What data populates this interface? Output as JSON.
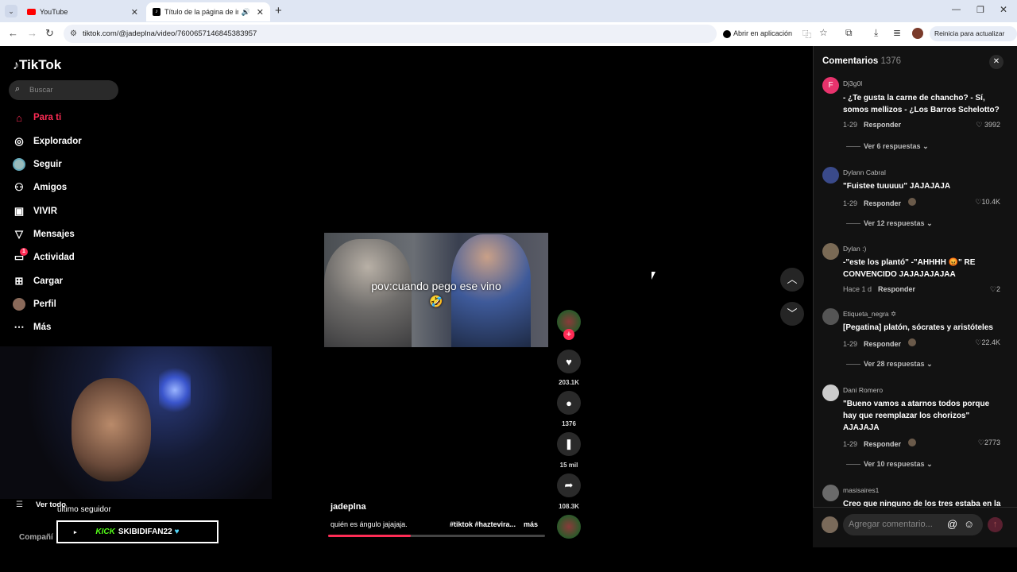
{
  "browser": {
    "tabs": [
      {
        "label": "YouTube",
        "active": false
      },
      {
        "label": "Título de la página de inicio",
        "active": true
      }
    ],
    "url": "tiktok.com/@jadeplna/video/7600657146845383957",
    "open_in_app": "Abrir en aplicación",
    "update_label": "Reinicia para actualizar"
  },
  "sidebar": {
    "logo": "TikTok",
    "search_placeholder": "Buscar",
    "items": [
      {
        "label": "Para ti",
        "icon": "home-icon",
        "active": true
      },
      {
        "label": "Explorador",
        "icon": "compass-icon"
      },
      {
        "label": "Seguir",
        "icon": "avatar"
      },
      {
        "label": "Amigos",
        "icon": "friends-icon"
      },
      {
        "label": "VIVIR",
        "icon": "live-icon"
      },
      {
        "label": "Mensajes",
        "icon": "send-icon"
      },
      {
        "label": "Actividad",
        "icon": "activity-icon",
        "badge": "1"
      },
      {
        "label": "Cargar",
        "icon": "upload-icon"
      },
      {
        "label": "Perfil",
        "icon": "avatar"
      },
      {
        "label": "Más",
        "icon": "more-icon"
      }
    ]
  },
  "overlay": {
    "ver_todo": "Ver todo",
    "ultimo_seguidor": "ultimo seguidor",
    "kick_label": "KICK",
    "follower_name": "SKIBIDIFAN22",
    "compania": "Compañí"
  },
  "video": {
    "caption_overlay": "pov:cuando pego ese vino 🤣",
    "author": "jadeplna",
    "description": "quién es ángulo jajajaja.",
    "hashtags": "#tiktok #haztevira...",
    "more": "más",
    "progress": 0.38
  },
  "actions": {
    "likes": "203.1K",
    "comments": "1376",
    "saves": "15 mil",
    "shares": "108.3K"
  },
  "comments_panel": {
    "title": "Comentarios",
    "count": "1376",
    "input_placeholder": "Agregar comentario...",
    "reply_label": "Responder",
    "comments": [
      {
        "user": "Dj3g0l",
        "text": "- ¿Te gusta la carne de chancho? - Sí, somos mellizos - ¿Los Barros Schelotto?",
        "date": "1-29",
        "likes": "3992",
        "replies": "Ver 6 respuestas",
        "avatar_color": "#e8336d",
        "avatar_letter": "F"
      },
      {
        "user": "Dylann Cabral",
        "text": "\"Fuistee tuuuuu\" JAJAJAJA",
        "date": "1-29",
        "likes": "10.4K",
        "replies": "Ver 12 respuestas",
        "avatar_color": "#3a4a8a"
      },
      {
        "user": "Dylan :)",
        "text": "-\"este los plantó\" -\"AHHHH 😡\" RE CONVENCIDO JAJAJAJAJAA",
        "date": "Hace 1 d",
        "likes": "2",
        "avatar_color": "#7a6a55"
      },
      {
        "user": "Etiqueta_negra ✡︎",
        "text": "[Pegatina] platón, sócrates y aristóteles",
        "date": "1-29",
        "likes": "22.4K",
        "replies": "Ver 28 respuestas",
        "avatar_color": "#555"
      },
      {
        "user": "Dani Romero",
        "text": "\"Bueno vamos a atarnos todos porque hay que reemplazar los chorizos\" AJAJAJA",
        "date": "1-29",
        "likes": "2773",
        "replies": "Ver 10 respuestas",
        "avatar_color": "#ccc"
      },
      {
        "user": "masisaires1",
        "text": "Creo que ninguno de los tres estaba en la",
        "avatar_color": "#6a6a6a"
      }
    ]
  },
  "colors": {
    "accent": "#fe2c55",
    "panel_bg": "#121212"
  }
}
